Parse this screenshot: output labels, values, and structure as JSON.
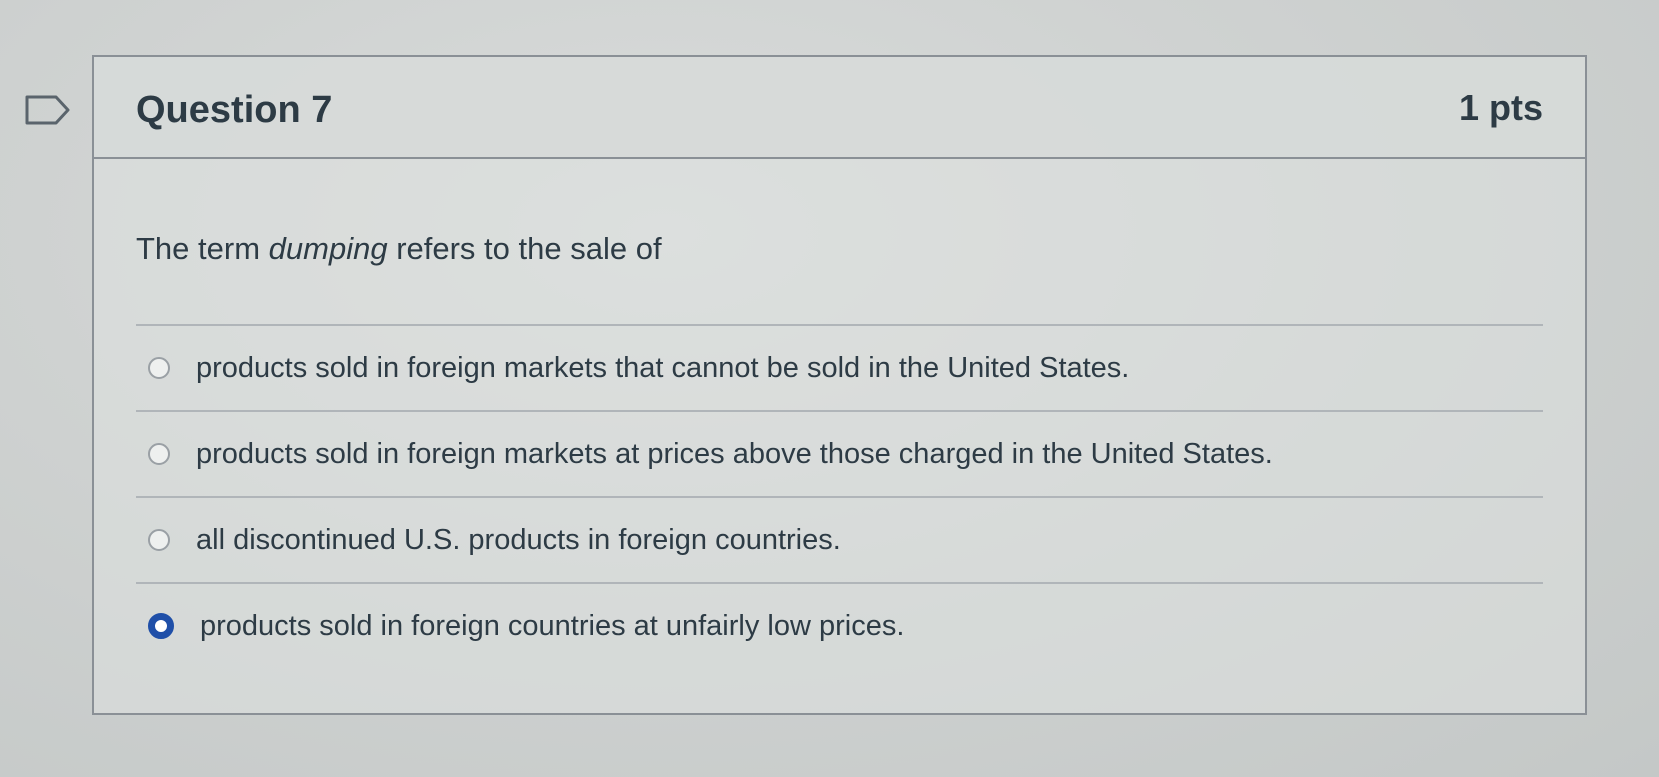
{
  "question": {
    "title": "Question 7",
    "points": "1 pts",
    "text_before": "The term ",
    "text_emphasis": "dumping",
    "text_after": " refers to the sale of",
    "flag_icon": "flag-outline-icon"
  },
  "answers": [
    {
      "label": "products sold in foreign markets that cannot be sold in the United States.",
      "selected": false
    },
    {
      "label": "products sold in foreign markets at prices above those charged in the United States.",
      "selected": false
    },
    {
      "label": "all discontinued U.S. products in foreign countries.",
      "selected": false
    },
    {
      "label": "products sold in foreign countries at unfairly low prices.",
      "selected": true
    }
  ],
  "colors": {
    "selected_radio": "#1f4fa8",
    "text": "#2d3b45",
    "border": "#8a9096"
  }
}
